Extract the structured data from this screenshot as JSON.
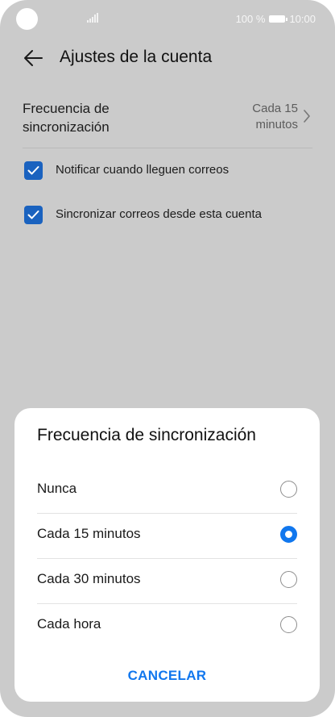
{
  "status_bar": {
    "battery": "100 %",
    "time": "10:00"
  },
  "header": {
    "title": "Ajustes de la cuenta"
  },
  "settings": {
    "sync_label": "Frecuencia de sincronización",
    "sync_value": "Cada 15 minutos",
    "checkboxes": [
      {
        "label": "Notificar cuando lleguen correos",
        "checked": true
      },
      {
        "label": "Sincronizar correos desde esta cuenta",
        "checked": true
      }
    ]
  },
  "dialog": {
    "title": "Frecuencia de sincronización",
    "options": [
      {
        "label": "Nunca",
        "selected": false
      },
      {
        "label": "Cada 15 minutos",
        "selected": true
      },
      {
        "label": "Cada 30 minutos",
        "selected": false
      },
      {
        "label": "Cada hora",
        "selected": false
      }
    ],
    "cancel_label": "CANCELAR"
  },
  "colors": {
    "accent": "#1177ee",
    "checkbox": "#1a62bf",
    "dim_background": "#cbcbcb"
  }
}
